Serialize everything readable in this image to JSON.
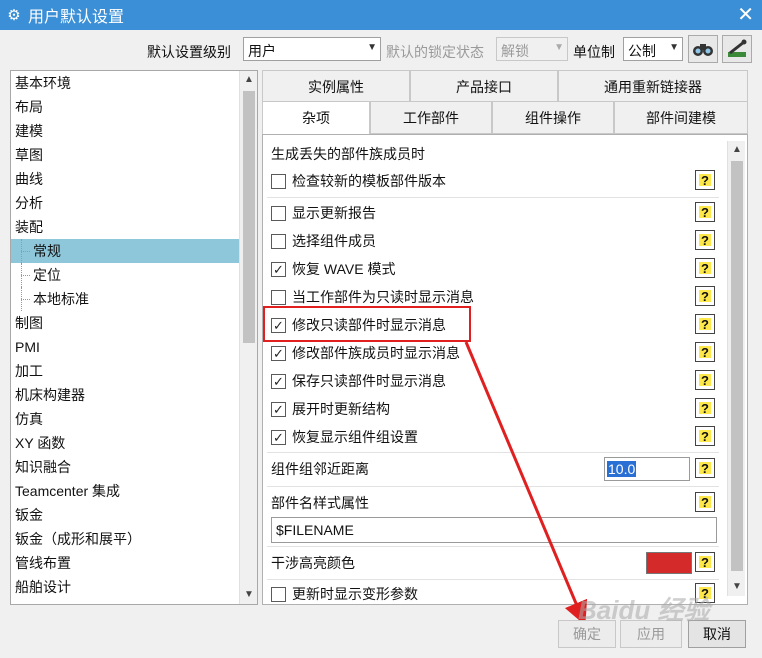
{
  "window": {
    "title": "用户默认设置"
  },
  "toolbar": {
    "level_label": "默认设置级别",
    "level_value": "用户",
    "lock_label": "默认的锁定状态",
    "lock_value": "解锁",
    "unit_label": "单位制",
    "unit_value": "公制"
  },
  "nav": {
    "items": [
      {
        "label": "基本环境",
        "level": 0,
        "selected": false
      },
      {
        "label": "布局",
        "level": 0,
        "selected": false
      },
      {
        "label": "建模",
        "level": 0,
        "selected": false
      },
      {
        "label": "草图",
        "level": 0,
        "selected": false
      },
      {
        "label": "曲线",
        "level": 0,
        "selected": false
      },
      {
        "label": "分析",
        "level": 0,
        "selected": false
      },
      {
        "label": "装配",
        "level": 0,
        "selected": false
      },
      {
        "label": "常规",
        "level": 1,
        "selected": true
      },
      {
        "label": "定位",
        "level": 1,
        "selected": false
      },
      {
        "label": "本地标准",
        "level": 1,
        "selected": false
      },
      {
        "label": "制图",
        "level": 0,
        "selected": false
      },
      {
        "label": "PMI",
        "level": 0,
        "selected": false
      },
      {
        "label": "加工",
        "level": 0,
        "selected": false
      },
      {
        "label": "机床构建器",
        "level": 0,
        "selected": false
      },
      {
        "label": "仿真",
        "level": 0,
        "selected": false
      },
      {
        "label": "XY 函数",
        "level": 0,
        "selected": false
      },
      {
        "label": "知识融合",
        "level": 0,
        "selected": false
      },
      {
        "label": "Teamcenter 集成",
        "level": 0,
        "selected": false
      },
      {
        "label": "钣金",
        "level": 0,
        "selected": false
      },
      {
        "label": "钣金（成形和展平）",
        "level": 0,
        "selected": false
      },
      {
        "label": "管线布置",
        "level": 0,
        "selected": false
      },
      {
        "label": "船舶设计",
        "level": 0,
        "selected": false
      }
    ]
  },
  "tabs": {
    "row1": [
      "实例属性",
      "产品接口",
      "通用重新链接器"
    ],
    "row2": [
      "杂项",
      "工作部件",
      "组件操作",
      "部件间建模"
    ],
    "active": "杂项"
  },
  "panel": {
    "section_title": "生成丢失的部件族成员时",
    "checkboxes": [
      {
        "label": "检查较新的模板部件版本",
        "checked": false
      },
      {
        "label": "显示更新报告",
        "checked": false
      },
      {
        "label": "选择组件成员",
        "checked": false
      },
      {
        "label": "恢复 WAVE 模式",
        "checked": true
      },
      {
        "label": "当工作部件为只读时显示消息",
        "checked": false
      },
      {
        "label": "修改只读部件时显示消息",
        "checked": true
      },
      {
        "label": "修改部件族成员时显示消息",
        "checked": true
      },
      {
        "label": "保存只读部件时显示消息",
        "checked": true
      },
      {
        "label": "展开时更新结构",
        "checked": true
      },
      {
        "label": "恢复显示组件组设置",
        "checked": true
      }
    ],
    "proximity_label": "组件组邻近距离",
    "proximity_value": "10.0",
    "name_attr_label": "部件名样式属性",
    "name_attr_value": "$FILENAME",
    "interference_label": "干涉高亮颜色",
    "interference_color": "#d42a2a",
    "last_checkbox": {
      "label": "更新时显示变形参数",
      "checked": false
    },
    "help_glyph": "?"
  },
  "buttons": {
    "ok": "确定",
    "apply": "应用",
    "cancel": "取消"
  },
  "annotation": {
    "color": "#e02020",
    "highlighted_item": "修改只读部件时显示消息"
  },
  "watermark": {
    "text": "Baidu 经验"
  }
}
